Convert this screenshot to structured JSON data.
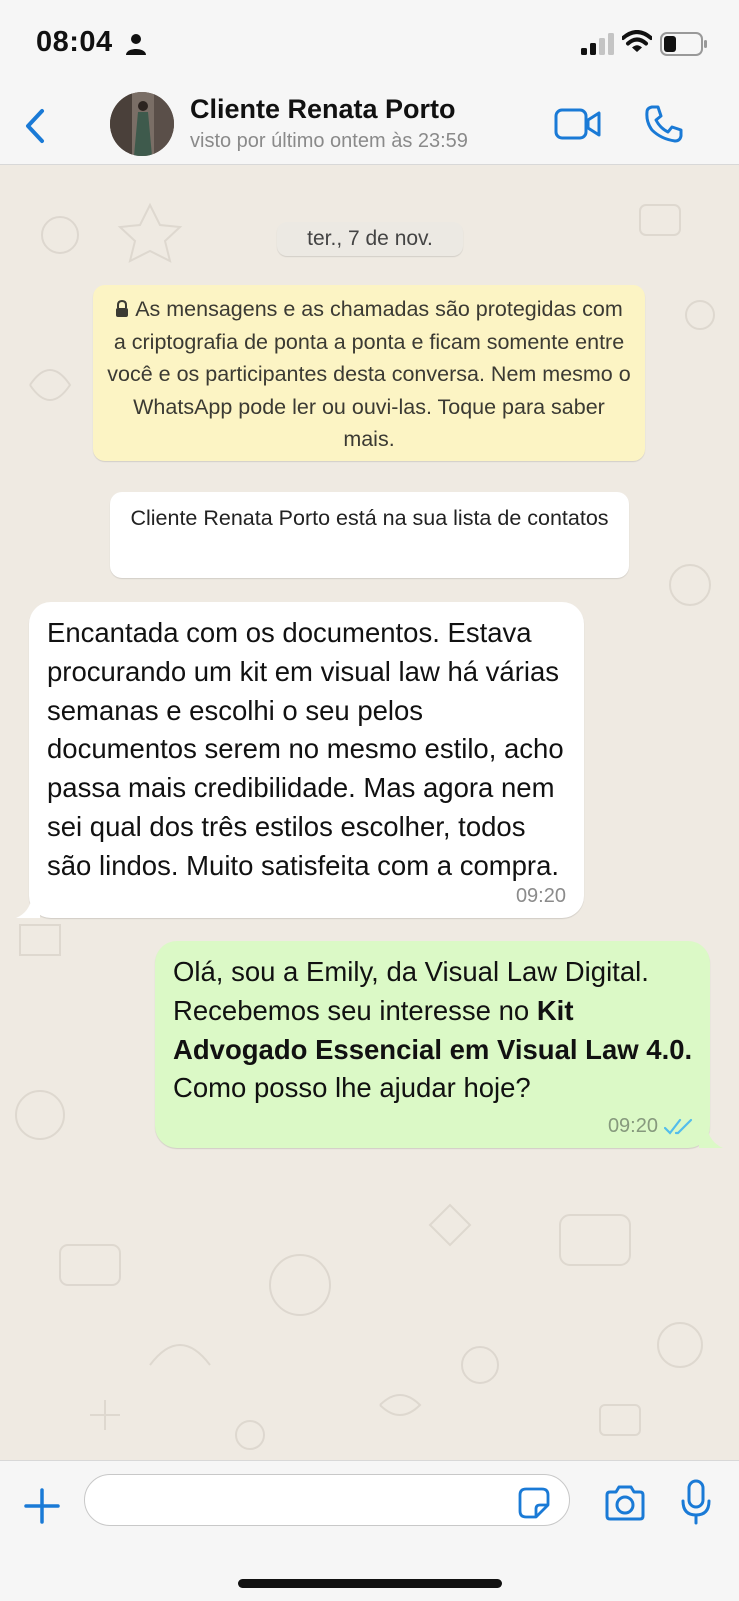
{
  "status_bar": {
    "time": "08:04",
    "battery_level": 0.35
  },
  "header": {
    "contact_name": "Cliente Renata Porto",
    "last_seen": "visto por último ontem às 23:59"
  },
  "chat": {
    "date_label": "ter., 7 de nov.",
    "encryption_notice": "As mensagens e as chamadas são protegidas com a criptografia de ponta a ponta e ficam somente entre você e os participantes desta conversa. Nem mesmo o WhatsApp pode ler ou ouvi-las. Toque para saber mais.",
    "contact_notice": "Cliente Renata Porto está na sua lista de contatos",
    "messages": [
      {
        "direction": "incoming",
        "text": "Encantada com os documentos. Estava procurando um kit em visual law há várias semanas e escolhi o seu pelos documentos serem no mesmo estilo, acho passa mais credibilidade. Mas agora nem sei qual dos três estilos escolher, todos são lindos. Muito satisfeita com a compra.",
        "time": "09:20"
      },
      {
        "direction": "outgoing",
        "text_before": "Olá, sou a Emily, da Visual Law Digital. Recebemos seu interesse no ",
        "text_bold": "Kit Advogado Essencial em Visual Law 4.0.",
        "text_after": " Como posso lhe ajudar hoje?",
        "time": "09:20",
        "status": "read"
      }
    ]
  },
  "input": {
    "placeholder": "",
    "value": ""
  },
  "colors": {
    "accent": "#1a7ad6",
    "chat_background": "#efeae2",
    "incoming_bubble": "#ffffff",
    "outgoing_bubble": "#dbf9c6",
    "notice_yellow": "#fcf4c4",
    "read_ticks": "#53bdeb"
  },
  "icons": {
    "back": "chevron-left-icon",
    "video": "video-camera-icon",
    "call": "phone-icon",
    "lock": "lock-icon",
    "read": "double-check-icon",
    "plus": "plus-icon",
    "sticker": "sticker-icon",
    "camera": "camera-icon",
    "mic": "microphone-icon"
  }
}
